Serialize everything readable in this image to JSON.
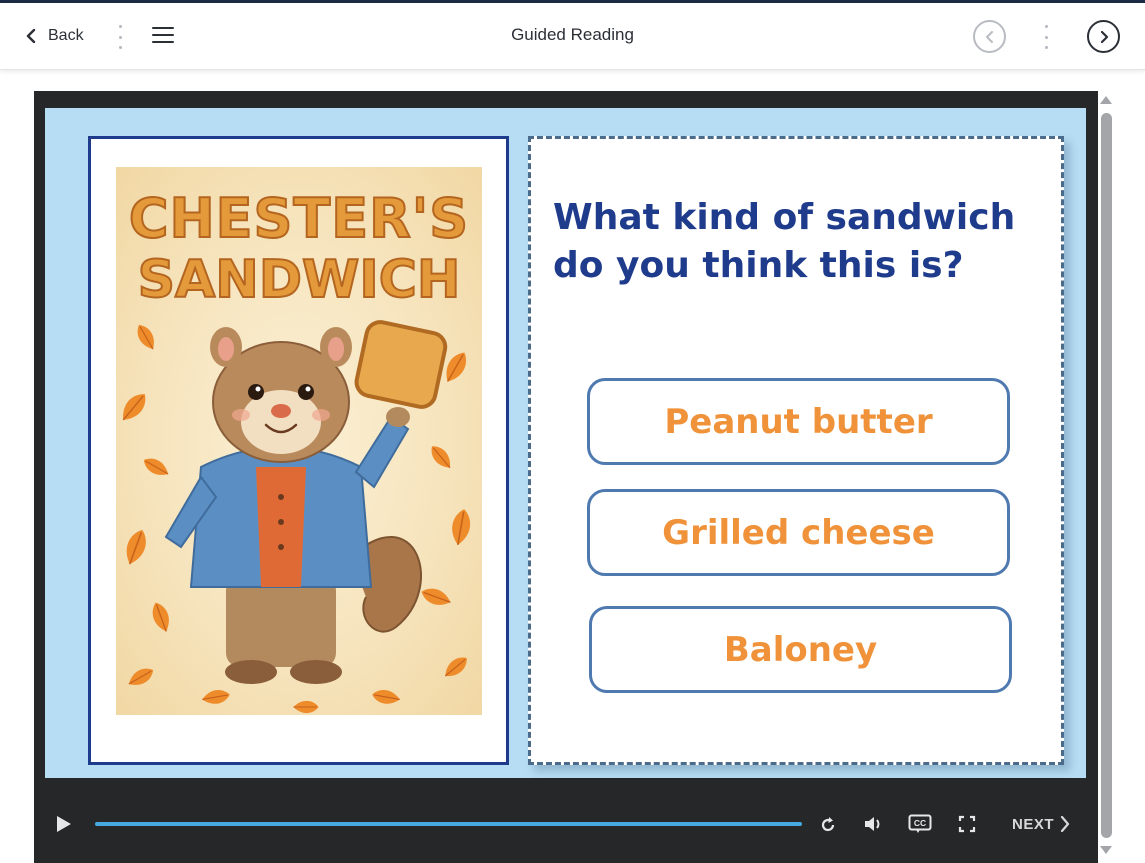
{
  "header": {
    "back_label": "Back",
    "title": "Guided Reading"
  },
  "book": {
    "cover_title_line1": "CHESTER'S",
    "cover_title_line2": "SANDWICH"
  },
  "quiz": {
    "question": "What kind of sandwich do you think this is?",
    "answers": [
      "Peanut butter",
      "Grilled cheese",
      "Baloney"
    ]
  },
  "player": {
    "next_label": "NEXT",
    "cc_label": "CC"
  },
  "colors": {
    "question_text": "#1f3b8c",
    "answer_text": "#ef923a",
    "answer_border": "#4f7ab0",
    "stage_bg": "#b6ddf3",
    "progress": "#46a9e4"
  },
  "icons": [
    "chevron-left-icon",
    "hamburger-menu-icon",
    "prev-circle-icon",
    "next-circle-icon",
    "play-icon",
    "replay-icon",
    "volume-icon",
    "closed-captions-icon",
    "fullscreen-icon",
    "chevron-right-icon"
  ]
}
